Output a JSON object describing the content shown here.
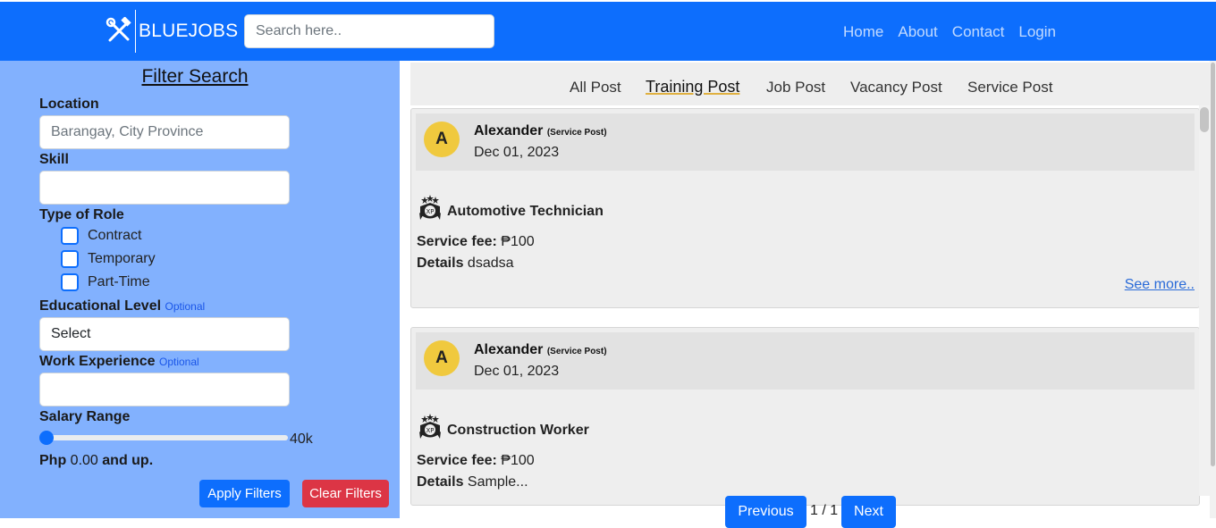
{
  "navbar": {
    "brand": "BLUEJOBS",
    "brand_icon": "hammer-wrench-icon",
    "search_placeholder": "Search here..",
    "links": [
      "Home",
      "About",
      "Contact",
      "Login"
    ]
  },
  "filters": {
    "title": "Filter Search",
    "location_label": "Location",
    "location_placeholder": "Barangay, City Province",
    "skill_label": "Skill",
    "skill_value": "",
    "role_label": "Type of Role",
    "roles": [
      "Contract",
      "Temporary",
      "Part-Time"
    ],
    "education_label": "Educational Level",
    "education_optional": "Optional",
    "education_value": "Select",
    "experience_label": "Work Experience",
    "experience_optional": "Optional",
    "experience_value": "",
    "salary_label": "Salary Range",
    "salary_max_label": "40k",
    "salary_value_fraction": 0,
    "salary_prefix": "Php",
    "salary_amount": "0.00",
    "salary_suffix": "and up.",
    "apply_label": "Apply Filters",
    "clear_label": "Clear Filters"
  },
  "tabs": [
    "All Post",
    "Training Post",
    "Job Post",
    "Vacancy Post",
    "Service Post"
  ],
  "active_tab": "Training Post",
  "posts": [
    {
      "avatar_letter": "A",
      "author": "Alexander",
      "post_type": "(Service Post)",
      "date": "Dec 01, 2023",
      "badge_icon": "xp-badge-icon",
      "title": "Automotive Technician",
      "fee_label": "Service fee:",
      "fee_value": "₱100",
      "details_label": "Details",
      "details_value": "dsadsa",
      "see_more": "See more.."
    },
    {
      "avatar_letter": "A",
      "author": "Alexander",
      "post_type": "(Service Post)",
      "date": "Dec 01, 2023",
      "badge_icon": "xp-badge-icon",
      "title": "Construction Worker",
      "fee_label": "Service fee:",
      "fee_value": "₱100",
      "details_label": "Details",
      "details_value": "Sample..."
    }
  ],
  "pagination": {
    "previous": "Previous",
    "info": "1 / 1",
    "next": "Next"
  },
  "colors": {
    "primary": "#0d6efd",
    "filter_panel": "#82b1fe",
    "danger": "#dc3545",
    "avatar": "#f0c93e"
  }
}
